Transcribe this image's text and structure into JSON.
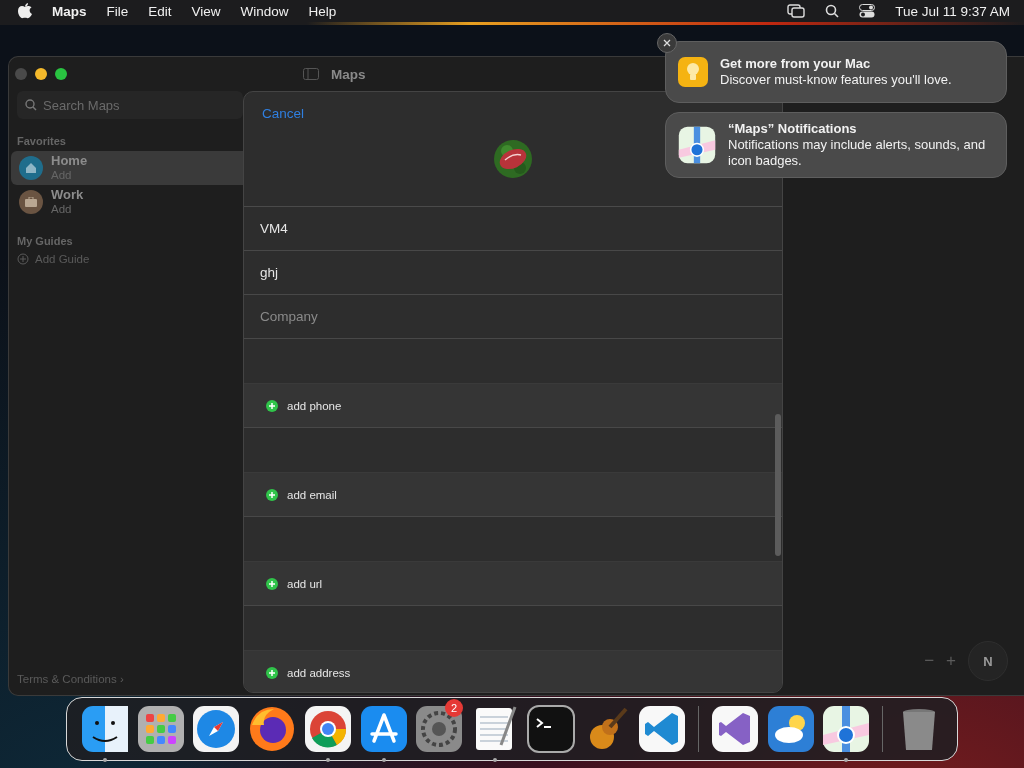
{
  "menu_bar": {
    "app": "Maps",
    "menus": [
      "File",
      "Edit",
      "View",
      "Window",
      "Help"
    ],
    "clock": "Tue Jul 11  9:37 AM"
  },
  "window": {
    "title": "Maps",
    "sidebar": {
      "search": {
        "placeholder": "Search Maps"
      },
      "sections": [
        {
          "title": "Favorites",
          "items": [
            {
              "kind": "home",
              "title": "Home",
              "subtitle": "Add",
              "selected": true
            },
            {
              "kind": "work",
              "title": "Work",
              "subtitle": "Add",
              "selected": false
            }
          ]
        },
        {
          "title": "My Guides",
          "items": [
            {
              "kind": "add",
              "title": "Add Guide",
              "selected": false
            }
          ]
        }
      ],
      "footer": "Terms & Conditions ›"
    },
    "sheet": {
      "cancel": "Cancel",
      "fields": [
        {
          "value": "VM4"
        },
        {
          "value": "ghj"
        },
        {
          "placeholder": "Company"
        }
      ],
      "add_rows": [
        "add phone",
        "add email",
        "add url",
        "add address"
      ]
    },
    "map_controls": {
      "zoom_out": "−",
      "zoom_in": "+",
      "compass": "N"
    }
  },
  "notifications": [
    {
      "kind": "tips",
      "title": "Get more from your Mac",
      "body": "Discover must-know features you'll love."
    },
    {
      "kind": "maps",
      "title": "“Maps” Notifications",
      "body": "Notifications may include alerts, sounds, and icon badges."
    }
  ],
  "dock": {
    "apps": [
      {
        "kind": "finder",
        "running": true
      },
      {
        "kind": "launchpad",
        "running": false
      },
      {
        "kind": "safari",
        "running": false
      },
      {
        "kind": "firefox",
        "running": false
      },
      {
        "kind": "chrome",
        "running": true
      },
      {
        "kind": "appstore",
        "running": true
      },
      {
        "kind": "settings",
        "running": false,
        "badge": "2"
      },
      {
        "kind": "textedit",
        "running": true
      },
      {
        "kind": "terminal",
        "running": false
      },
      {
        "kind": "garageband",
        "running": false
      },
      {
        "kind": "vscode",
        "running": false
      }
    ],
    "recent": [
      {
        "kind": "visualstudio",
        "running": false
      },
      {
        "kind": "weather",
        "running": false
      },
      {
        "kind": "maps",
        "running": true
      }
    ],
    "trash": {
      "running": false
    }
  }
}
